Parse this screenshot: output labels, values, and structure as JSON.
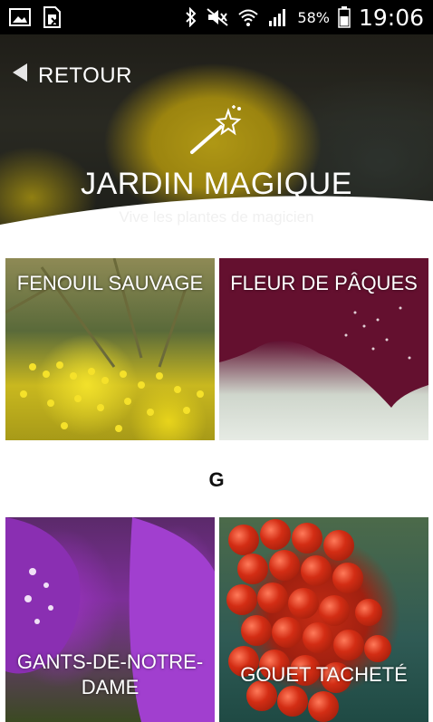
{
  "status_bar": {
    "battery_percent": "58%",
    "time": "19:06",
    "icons": [
      "image-icon",
      "sim-card-icon",
      "bluetooth-icon",
      "mute-icon",
      "wifi-icon",
      "signal-icon",
      "battery-icon"
    ]
  },
  "header": {
    "back_label": "RETOUR",
    "title": "JARDIN MAGIQUE",
    "subtitle": "Vive les plantes de magicien",
    "icon": "magic-wand-icon"
  },
  "sections": [
    {
      "letter": "",
      "items": [
        {
          "label": "FENOUIL SAUVAGE"
        },
        {
          "label": "FLEUR DE PÂQUES"
        }
      ]
    },
    {
      "letter": "G",
      "items": [
        {
          "label": "GANTS-DE-NOTRE-DAME"
        },
        {
          "label": "GOUET TACHETÉ"
        }
      ]
    }
  ],
  "colors": {
    "status_bar_bg": "#000000",
    "page_bg": "#ffffff",
    "text_on_image": "#ffffff"
  }
}
